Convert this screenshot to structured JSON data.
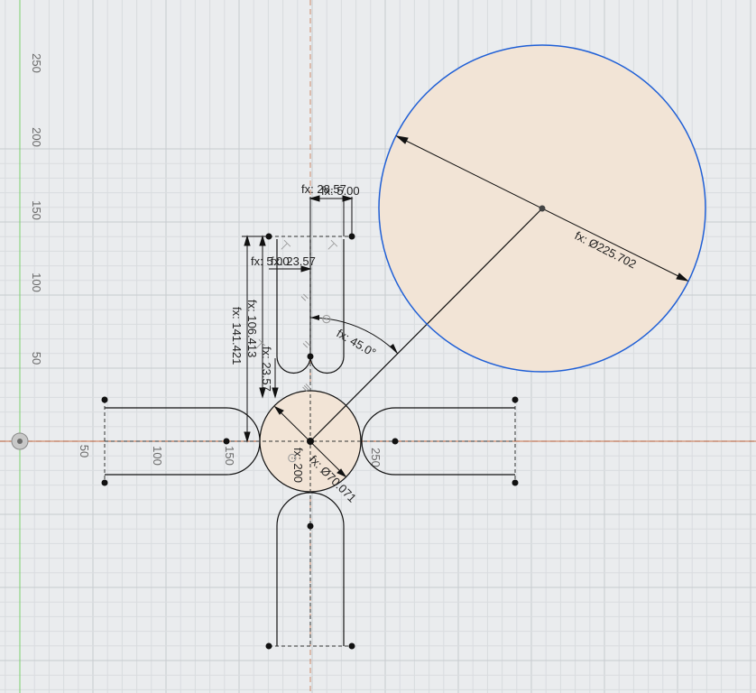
{
  "colors": {
    "background": "#eaecee",
    "grid_minor": "#d9dcdf",
    "grid_major": "#c7cbcf",
    "x_axis": "#c9724a",
    "y_axis": "#7ccf6e",
    "sketch_line": "#111111",
    "profile_fill": "#f2e4d6",
    "selected_circle": "#1f5fd6",
    "constraint_glyph": "#9a9a9a"
  },
  "vertical_ruler": [
    "250",
    "200",
    "150",
    "100",
    "50"
  ],
  "horizontal_ruler": [
    "50",
    "100",
    "150",
    "200",
    "250"
  ],
  "dimensions": {
    "top_width": "fx: 28.57",
    "top_offset": "fx: 5.00",
    "inner_width": "fx: 5.00",
    "inner_width_b": "fx: 23.57",
    "height_a": "fx: 106.413",
    "height_b": "fx: 141.421",
    "slot_gap": "fx: 23.57",
    "angle": "fx: 45.0°",
    "big_diameter": "fx: Ø225.702",
    "small_diameter": "fx: Ø70.071",
    "center_mark": "fx: 200"
  },
  "glyph_names": [
    "equal-constraint-icon",
    "tangent-constraint-icon",
    "perpendicular-constraint-icon"
  ]
}
